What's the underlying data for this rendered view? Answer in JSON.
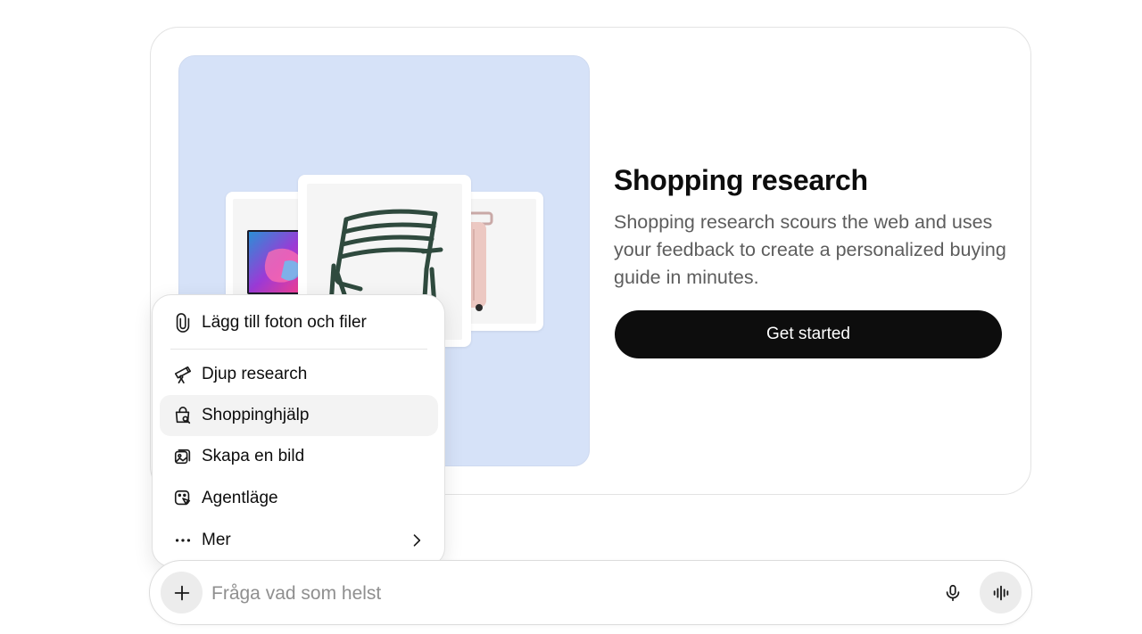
{
  "feature_card": {
    "title": "Shopping research",
    "description": "Shopping research scours the web and uses your feedback to create a personalized buying guide in minutes.",
    "cta_label": "Get started",
    "illustration": {
      "background_color": "#d6e2f8",
      "products": [
        "tv",
        "chair",
        "suitcase"
      ]
    }
  },
  "menu": {
    "items": [
      {
        "label": "Lägg till foton och filer",
        "icon": "paperclip-icon"
      },
      {
        "label": "Djup research",
        "icon": "telescope-icon"
      },
      {
        "label": "Shoppinghjälp",
        "icon": "shopping-bag-search-icon",
        "active": true
      },
      {
        "label": "Skapa en bild",
        "icon": "image-create-icon"
      },
      {
        "label": "Agentläge",
        "icon": "agent-cursor-icon"
      },
      {
        "label": "Mer",
        "icon": "more-dots-icon",
        "has_submenu": true
      }
    ]
  },
  "composer": {
    "placeholder": "Fråga vad som helst",
    "value": "",
    "left_button_icon": "plus-icon",
    "mic_icon": "microphone-icon",
    "voice_icon": "voice-waveform-icon"
  },
  "colors": {
    "cta_background": "#0d0d0d",
    "active_item_background": "#f3f3f3"
  }
}
